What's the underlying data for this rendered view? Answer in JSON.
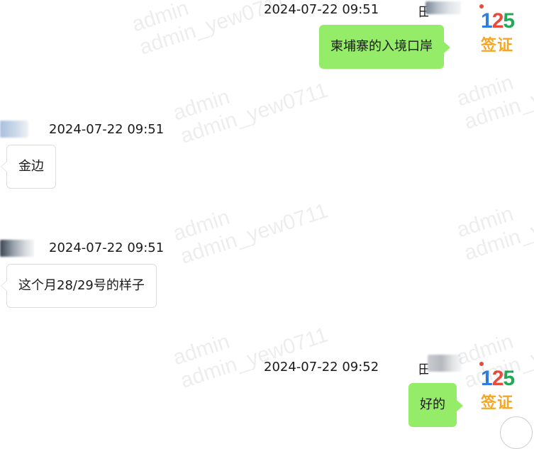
{
  "watermark": {
    "line1": "admin",
    "line2": "admin_yew0711"
  },
  "messages": [
    {
      "direction": "outgoing",
      "time": "2024-07-22 09:51",
      "sender": "田",
      "text": "柬埔寨的入境口岸"
    },
    {
      "direction": "incoming",
      "time": "2024-07-22 09:51",
      "text": "金边"
    },
    {
      "direction": "incoming",
      "time": "2024-07-22 09:51",
      "text": "这个月28/29号的样子"
    },
    {
      "direction": "outgoing",
      "time": "2024-07-22 09:52",
      "sender": "田",
      "text": "好的"
    }
  ],
  "avatar_logo": {
    "number": [
      "1",
      "2",
      "5"
    ],
    "text": "签证"
  },
  "colors": {
    "outgoing_bubble": "#95ec69",
    "incoming_bubble": "#ffffff",
    "logo_text": "#f5a623"
  },
  "icons": {
    "scroll": "circle-button-icon"
  }
}
